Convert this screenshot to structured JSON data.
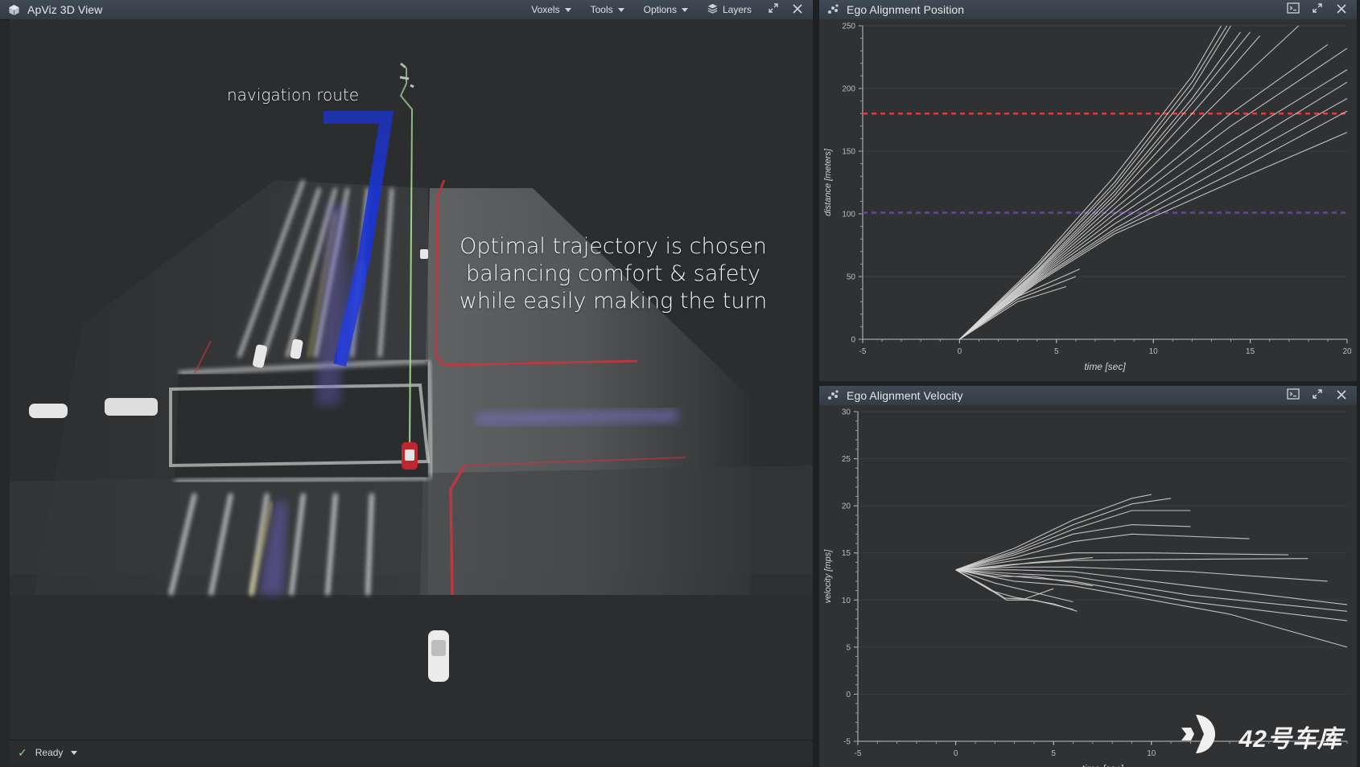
{
  "viewer": {
    "title": "ApViz 3D View",
    "title_icon": "cube-icon",
    "menus": [
      {
        "label": "Voxels"
      },
      {
        "label": "Tools"
      },
      {
        "label": "Options"
      },
      {
        "label": "Layers",
        "icon": "layers-icon"
      }
    ],
    "status": "Ready",
    "annotations": {
      "nav_route": "navigation route",
      "caption_lines": [
        "Optimal trajectory is chosen",
        "balancing comfort & safety",
        "while easily making the turn"
      ]
    },
    "colors": {
      "route_line": "#9ed48a",
      "nav_route": "#1b34d6",
      "curb": "#c8363b",
      "ego_car": "#c0262d"
    }
  },
  "position_panel": {
    "title": "Ego Alignment Position",
    "chart_data": {
      "type": "line",
      "xlabel": "time [sec]",
      "ylabel": "distance [meters]",
      "xlim": [
        -5,
        20
      ],
      "ylim": [
        0,
        250
      ],
      "xticks": [
        -5,
        0,
        5,
        10,
        15,
        20
      ],
      "yticks": [
        0,
        50,
        100,
        150,
        200,
        250
      ],
      "reference_lines": [
        {
          "y": 180,
          "color": "#e23b3b",
          "style": "dashed"
        },
        {
          "y": 101,
          "color": "#6b3fa6",
          "style": "dashed"
        }
      ],
      "series_color": "#d9d9d9",
      "trajectories": [
        [
          [
            0,
            0
          ],
          [
            4,
            60
          ],
          [
            8,
            130
          ],
          [
            12,
            210
          ],
          [
            13.5,
            250
          ]
        ],
        [
          [
            0,
            0
          ],
          [
            4,
            58
          ],
          [
            8,
            125
          ],
          [
            12,
            205
          ],
          [
            13.8,
            250
          ]
        ],
        [
          [
            0,
            0
          ],
          [
            4,
            57
          ],
          [
            8,
            122
          ],
          [
            12,
            200
          ],
          [
            14,
            250
          ]
        ],
        [
          [
            0,
            0
          ],
          [
            4,
            55
          ],
          [
            8,
            118
          ],
          [
            12,
            192
          ],
          [
            14.5,
            245
          ]
        ],
        [
          [
            0,
            0
          ],
          [
            4,
            54
          ],
          [
            8,
            115
          ],
          [
            12,
            188
          ],
          [
            15,
            245
          ]
        ],
        [
          [
            0,
            0
          ],
          [
            4,
            53
          ],
          [
            8,
            112
          ],
          [
            12,
            180
          ],
          [
            15.5,
            242
          ]
        ],
        [
          [
            0,
            0
          ],
          [
            4,
            52
          ],
          [
            8,
            108
          ],
          [
            14,
            200
          ],
          [
            17.5,
            250
          ]
        ],
        [
          [
            0,
            0
          ],
          [
            4,
            51
          ],
          [
            8,
            104
          ],
          [
            14,
            180
          ],
          [
            19,
            235
          ]
        ],
        [
          [
            0,
            0
          ],
          [
            4,
            50
          ],
          [
            8,
            100
          ],
          [
            14,
            170
          ],
          [
            20,
            232
          ]
        ],
        [
          [
            0,
            0
          ],
          [
            4,
            49
          ],
          [
            8,
            96
          ],
          [
            14,
            158
          ],
          [
            20,
            215
          ]
        ],
        [
          [
            0,
            0
          ],
          [
            4,
            48
          ],
          [
            8,
            92
          ],
          [
            14,
            148
          ],
          [
            20,
            205
          ]
        ],
        [
          [
            0,
            0
          ],
          [
            4,
            47
          ],
          [
            8,
            88
          ],
          [
            14,
            140
          ],
          [
            20,
            192
          ]
        ],
        [
          [
            0,
            0
          ],
          [
            4,
            46
          ],
          [
            8,
            86
          ],
          [
            14,
            132
          ],
          [
            20,
            182
          ]
        ],
        [
          [
            0,
            0
          ],
          [
            4,
            45
          ],
          [
            8,
            84
          ],
          [
            14,
            125
          ],
          [
            20,
            165
          ]
        ],
        [
          [
            0,
            0
          ],
          [
            3,
            32
          ],
          [
            6,
            50
          ]
        ],
        [
          [
            0,
            0
          ],
          [
            3,
            30
          ],
          [
            5.5,
            42
          ]
        ],
        [
          [
            0,
            0
          ],
          [
            3,
            34
          ],
          [
            6.2,
            56
          ]
        ]
      ]
    }
  },
  "velocity_panel": {
    "title": "Ego Alignment Velocity",
    "chart_data": {
      "type": "line",
      "xlabel": "time [sec]",
      "ylabel": "velocity [mps]",
      "xlim": [
        -5,
        20
      ],
      "ylim": [
        -5,
        30
      ],
      "xticks": [
        -5,
        0,
        5,
        10
      ],
      "yticks": [
        -5,
        0,
        5,
        10,
        15,
        20,
        25,
        30
      ],
      "series_color": "#d9d9d9",
      "trajectories": [
        [
          [
            0,
            13.2
          ],
          [
            3,
            15.5
          ],
          [
            6,
            18.5
          ],
          [
            9,
            20.8
          ],
          [
            10,
            21.2
          ]
        ],
        [
          [
            0,
            13.2
          ],
          [
            3,
            15.2
          ],
          [
            6,
            18
          ],
          [
            9,
            20.2
          ],
          [
            11,
            20.8
          ]
        ],
        [
          [
            0,
            13.2
          ],
          [
            3,
            15
          ],
          [
            6,
            17.5
          ],
          [
            9,
            19.5
          ],
          [
            12,
            19.5
          ]
        ],
        [
          [
            0,
            13.2
          ],
          [
            3,
            14.8
          ],
          [
            6,
            17
          ],
          [
            9,
            18
          ],
          [
            12,
            17.8
          ]
        ],
        [
          [
            0,
            13.2
          ],
          [
            3,
            14.5
          ],
          [
            6,
            16.2
          ],
          [
            9,
            17
          ],
          [
            15,
            16.5
          ]
        ],
        [
          [
            0,
            13.2
          ],
          [
            3,
            14.2
          ],
          [
            6,
            15
          ],
          [
            10,
            15
          ],
          [
            17,
            14.8
          ]
        ],
        [
          [
            0,
            13.2
          ],
          [
            3,
            13.8
          ],
          [
            6,
            14.2
          ],
          [
            10,
            14.3
          ],
          [
            18,
            14.4
          ]
        ],
        [
          [
            0,
            13.2
          ],
          [
            3,
            13.5
          ],
          [
            6,
            13.5
          ],
          [
            12,
            13
          ],
          [
            19,
            12
          ]
        ],
        [
          [
            0,
            13.2
          ],
          [
            3,
            13.2
          ],
          [
            6,
            13
          ],
          [
            12,
            11.5
          ],
          [
            20,
            9.5
          ]
        ],
        [
          [
            0,
            13.2
          ],
          [
            3,
            12.8
          ],
          [
            6,
            12.5
          ],
          [
            12,
            10.5
          ],
          [
            20,
            8.8
          ]
        ],
        [
          [
            0,
            13.2
          ],
          [
            3,
            12.5
          ],
          [
            6,
            12
          ],
          [
            12,
            9.8
          ],
          [
            20,
            7.8
          ]
        ],
        [
          [
            0,
            13.2
          ],
          [
            3,
            12
          ],
          [
            6,
            11.5
          ],
          [
            14,
            8.5
          ],
          [
            20,
            5
          ]
        ],
        [
          [
            0,
            13.2
          ],
          [
            1.5,
            11.5
          ],
          [
            2.5,
            10.2
          ],
          [
            3.5,
            10.1
          ],
          [
            5,
            11.2
          ]
        ],
        [
          [
            0,
            13.2
          ],
          [
            1.6,
            11.3
          ],
          [
            2.6,
            10
          ],
          [
            4,
            10
          ],
          [
            6,
            9
          ]
        ],
        [
          [
            0,
            13.2
          ],
          [
            1.8,
            11
          ],
          [
            3,
            10.3
          ],
          [
            5,
            9.6
          ],
          [
            6.2,
            8.8
          ]
        ],
        [
          [
            0,
            13.2
          ],
          [
            2,
            11.8
          ],
          [
            4,
            10.8
          ],
          [
            6,
            9.8
          ]
        ],
        [
          [
            0,
            13.2
          ],
          [
            2,
            12.5
          ],
          [
            4,
            12.5
          ],
          [
            7,
            11.5
          ]
        ],
        [
          [
            0,
            13.2
          ],
          [
            2,
            13.5
          ],
          [
            4,
            14
          ],
          [
            7,
            14.5
          ]
        ]
      ]
    }
  },
  "watermark": {
    "text": "42号车库",
    "icon": "brand-logo-icon"
  }
}
